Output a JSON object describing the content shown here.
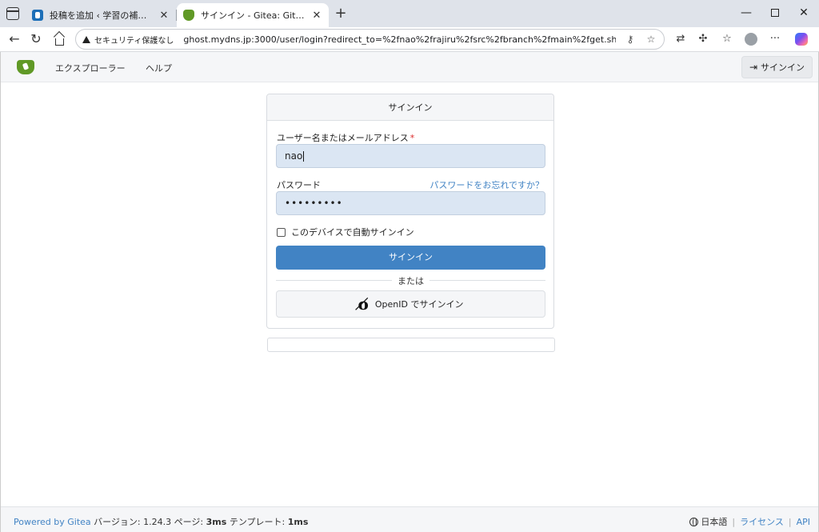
{
  "browser": {
    "tabs": [
      {
        "title": "投稿を追加 ‹ 学習の補助をめざす —",
        "active": false
      },
      {
        "title": "サインイン - Gitea: Git with a cup of tea",
        "active": true
      }
    ],
    "security_label": "セキュリティ保護なし",
    "url": "ghost.mydns.jp:3000/user/login?redirect_to=%2fnao%2frajiru%2fsrc%2fbranch%2fmain%2fget.sh",
    "colors": {
      "tabbar": "#dfe3ea",
      "active_tab": "#ffffff"
    }
  },
  "navbar": {
    "explore": "エクスプローラー",
    "help": "ヘルプ",
    "signin": "サインイン"
  },
  "login": {
    "title": "サインイン",
    "username_label": "ユーザー名またはメールアドレス",
    "required_mark": "*",
    "username_value": "nao",
    "password_label": "パスワード",
    "forgot_link": "パスワードをお忘れですか？",
    "password_value": "•••••••••",
    "remember_label": "このデバイスで自動サインイン",
    "remember_checked": false,
    "submit": "サインイン",
    "or": "または",
    "openid_button": "OpenID でサインイン"
  },
  "footer": {
    "powered_by": "Powered by Gitea",
    "version_label": "バージョン:",
    "version": "1.24.3",
    "page_label": "ページ:",
    "page_time": "3ms",
    "template_label": "テンプレート:",
    "template_time": "1ms",
    "language": "日本語",
    "license": "ライセンス",
    "api": "API"
  },
  "theme": {
    "primary": "#4183c4",
    "brand": "#609926",
    "input_bg": "#dbe6f3"
  }
}
